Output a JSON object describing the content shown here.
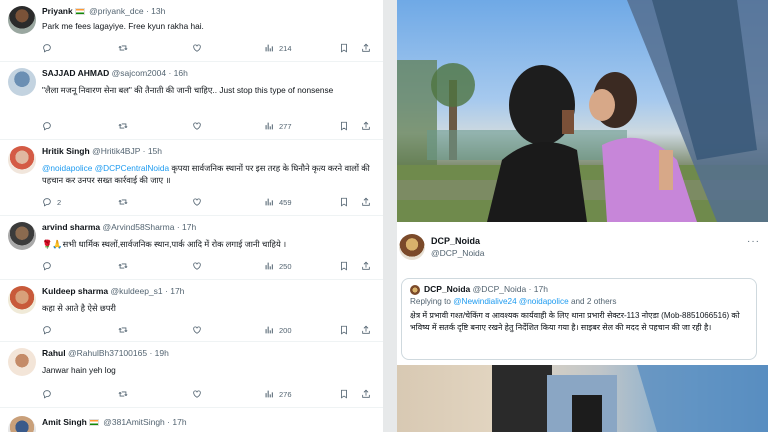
{
  "replies": [
    {
      "name": "Priyank",
      "flag": true,
      "handle": "@priyank_dce",
      "time": "13h",
      "text": "Park me fees lagayiye. Free kyun rakha hai.",
      "metrics": {
        "replies": "",
        "retweets": "",
        "likes": "",
        "views": "214"
      }
    },
    {
      "name": "SAJJAD AHMAD",
      "flag": false,
      "handle": "@sajcom2004",
      "time": "16h",
      "text": "\"लैला मजनू निवारण सेना बल\" की तैनाती की जानी चाहिए.. Just stop this type of nonsense",
      "metrics": {
        "replies": "",
        "retweets": "",
        "likes": "",
        "views": "277"
      }
    },
    {
      "name": "Hritik Singh",
      "flag": false,
      "handle": "@Hritik4BJP",
      "time": "15h",
      "mentions": "@noidapolice @DCPCentralNoida",
      "text": "कृपया सार्वजनिक स्थानों पर इस तरह के घिनौने कृत्य करने वालों की पहचान कर उनपर सख्त कार्रवाई की जाए ॥",
      "metrics": {
        "replies": "2",
        "retweets": "",
        "likes": "",
        "views": "459"
      }
    },
    {
      "name": "arvind sharma",
      "flag": false,
      "handle": "@Arvind58Sharma",
      "time": "17h",
      "text": "🌹🙏सभी धार्मिक स्थलों,सार्वजनिक स्थान,पार्क आदि में रोक लगाई जानी चाहिये ।",
      "metrics": {
        "replies": "",
        "retweets": "",
        "likes": "",
        "views": "250"
      }
    },
    {
      "name": "Kuldeep sharma",
      "flag": false,
      "handle": "@kuldeep_s1",
      "time": "17h",
      "text": "कहा से आते है ऐसे छपरी",
      "metrics": {
        "replies": "",
        "retweets": "",
        "likes": "",
        "views": "200"
      }
    },
    {
      "name": "Rahul",
      "flag": false,
      "handle": "@RahulBh37100165",
      "time": "19h",
      "text": "Janwar hain yeh log",
      "metrics": {
        "replies": "",
        "retweets": "",
        "likes": "",
        "views": "276"
      }
    },
    {
      "name": "Amit Singh",
      "flag": true,
      "handle": "@381AmitSingh",
      "time": "17h",
      "text": "",
      "metrics": {
        "replies": "",
        "retweets": "",
        "likes": "",
        "views": ""
      }
    }
  ],
  "dcp_post": {
    "name": "DCP_Noida",
    "handle": "@DCP_Noida",
    "more": "···"
  },
  "quoted": {
    "name": "DCP_Noida",
    "handle": "@DCP_Noida",
    "time": "17h",
    "replying_prefix": "Replying to",
    "replying_users": "@Newindialive24 @noidapolice",
    "replying_suffix": "and 2 others",
    "text": "क्षेत्र में प्रभावी गश्त/चेकिंग व आवश्यक कार्यवाही के लिए थाना प्रभारी सेक्टर-113 नोएडा (Mob-8851066516) को भविष्य में सतर्क दृष्टि बनाए रखने हेतु निर्देशित किया गया है। साइबर सेल की मदद से पहचान की जा रही है।"
  },
  "colors": {
    "link": "#1d9bf0",
    "secondary_text": "#536471",
    "divider": "#eff3f4"
  },
  "icons": [
    "reply-icon",
    "retweet-icon",
    "like-icon",
    "views-icon",
    "bookmark-icon",
    "share-icon",
    "india-flag-icon",
    "more-icon"
  ]
}
